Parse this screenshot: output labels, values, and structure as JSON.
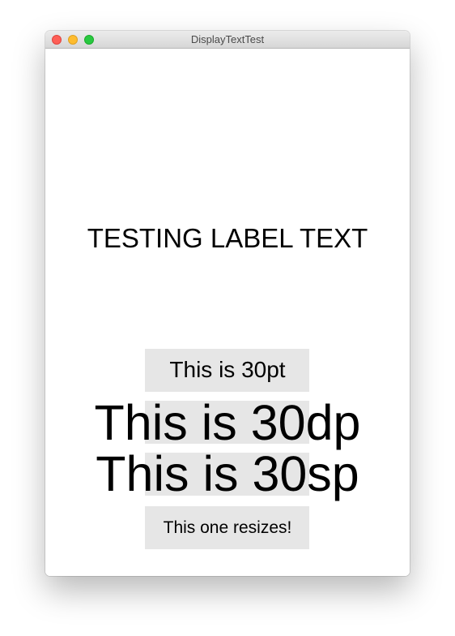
{
  "window": {
    "title": "DisplayTextTest"
  },
  "content": {
    "label_text": "TESTING LABEL TEXT",
    "text_30pt": "This is 30pt",
    "text_30dp": "This is 30dp",
    "text_30sp": "This is 30sp",
    "text_resizes": "This one resizes!"
  },
  "colors": {
    "traffic_close": "#fe5f57",
    "traffic_minimize": "#febc2e",
    "traffic_zoom": "#28c840",
    "label_background": "#e6e6e6",
    "text": "#000000"
  }
}
